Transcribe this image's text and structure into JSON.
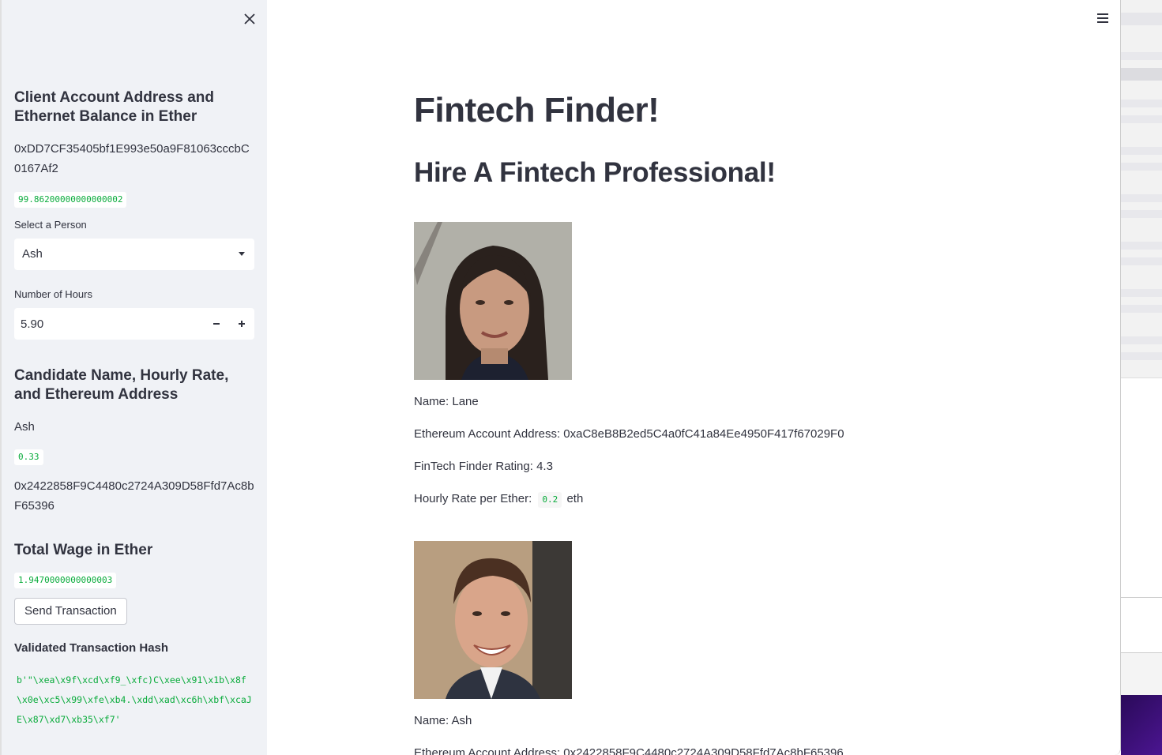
{
  "sidebar": {
    "client_heading": "Client Account Address and Ethernet Balance in Ether",
    "client_address": "0xDD7CF35405bf1E993e50a9F81063cccbC0167Af2",
    "client_balance": "99.86200000000000002",
    "select_label": "Select a Person",
    "select_value": "Ash",
    "hours_label": "Number of Hours",
    "hours_value": "5.90",
    "candidate_heading": "Candidate Name, Hourly Rate, and Ethereum Address",
    "candidate_name": "Ash",
    "candidate_rate": "0.33",
    "candidate_address": "0x2422858F9C4480c2724A309D58Ffd7Ac8bF65396",
    "wage_heading": "Total Wage in Ether",
    "wage_value": "1.9470000000000003",
    "send_button": "Send Transaction",
    "hash_heading": "Validated Transaction Hash",
    "hash_value": "b'\"\\xea\\x9f\\xcd\\xf9_\\xfc)C\\xee\\x91\\x1b\\x8f\\x0e\\xc5\\x99\\xfe\\xb4.\\xdd\\xad\\xc6h\\xbf\\xcaJE\\x87\\xd7\\xb35\\xf7'"
  },
  "main": {
    "title": "Fintech Finder!",
    "subtitle": "Hire A Fintech Professional!",
    "candidates": [
      {
        "name_line": "Name: Lane",
        "address_line": "Ethereum Account Address: 0xaC8eB8B2ed5C4a0fC41a84Ee4950F417f67029F0",
        "rating_line": "FinTech Finder Rating: 4.3",
        "rate_label": "Hourly Rate per Ether:",
        "rate_value": "0.2",
        "rate_unit": "eth"
      },
      {
        "name_line": "Name: Ash",
        "address_line": "Ethereum Account Address: 0x2422858F9C4480c2724A309D58Ffd7Ac8bF65396"
      }
    ]
  },
  "colors": {
    "sidebar_bg": "#f0f2f6",
    "code_green": "#09ab3b",
    "text": "#31333f"
  },
  "icons": {
    "close": "close-icon",
    "menu": "hamburger-menu-icon",
    "dropdown": "chevron-down-icon",
    "minus": "minus-icon",
    "plus": "plus-icon"
  }
}
